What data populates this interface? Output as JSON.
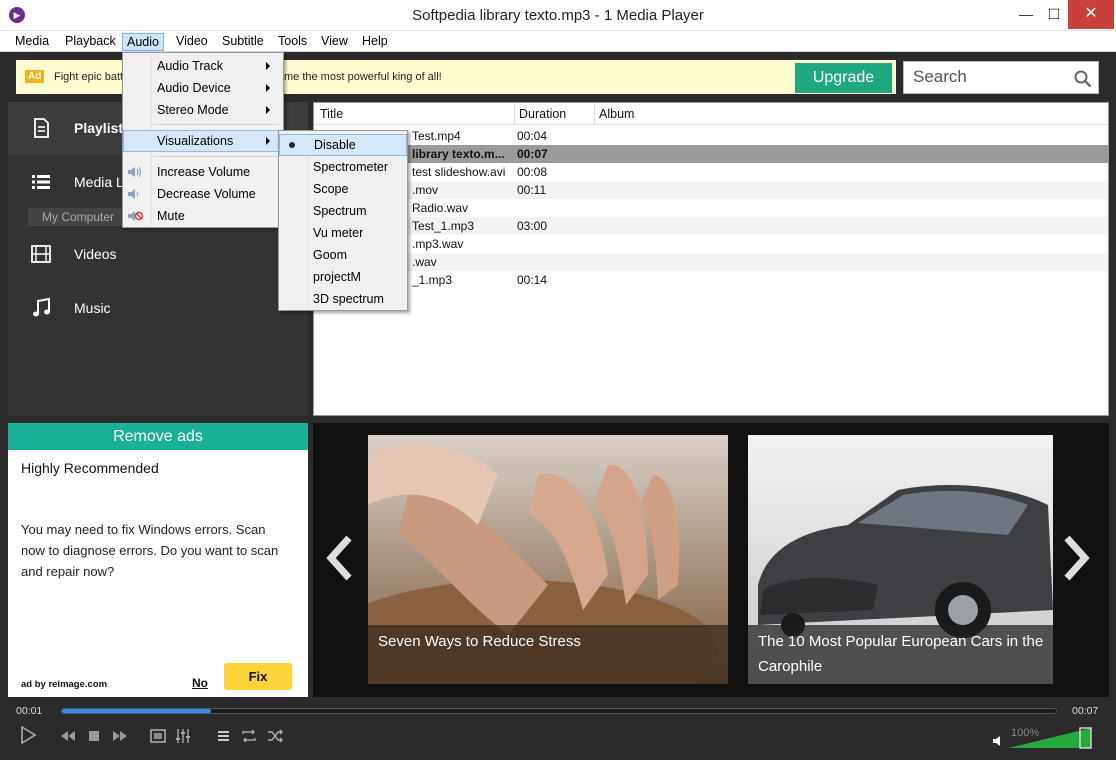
{
  "window": {
    "title": "Softpedia library texto.mp3 - 1 Media Player",
    "minimize": "—",
    "maximize": "☐",
    "close": "✕"
  },
  "menubar": [
    "Media",
    "Playback",
    "Audio",
    "Video",
    "Subtitle",
    "Tools",
    "View",
    "Help"
  ],
  "ad": {
    "badge": "Ad",
    "text_left": "Fight epic batt",
    "text_right": "me the most powerful king of all!",
    "upgrade": "Upgrade"
  },
  "search": {
    "placeholder": "Search"
  },
  "sidebar": {
    "playlist": "Playlist",
    "media_library": "Media Li",
    "my_computer": "My Computer",
    "videos": "Videos",
    "music": "Music"
  },
  "playlist": {
    "columns": [
      "Title",
      "Duration",
      "Album"
    ],
    "rows": [
      {
        "title": "Test.mp4",
        "duration": "00:04"
      },
      {
        "title": "library texto.m...",
        "duration": "00:07",
        "playing": true
      },
      {
        "title": "test slideshow.avi",
        "duration": "00:08"
      },
      {
        "title": ".mov",
        "duration": "00:11"
      },
      {
        "title": "Radio.wav",
        "duration": ""
      },
      {
        "title": "Test_1.mp3",
        "duration": "03:00"
      },
      {
        "title": ".mp3.wav",
        "duration": ""
      },
      {
        "title": ".wav",
        "duration": ""
      },
      {
        "title": "_1.mp3",
        "duration": "00:14"
      }
    ]
  },
  "recommend": {
    "header": "Remove ads",
    "title": "Highly Recommended",
    "message": "You may need to fix Windows errors. Scan now to diagnose errors. Do you want to scan and repair now?",
    "by": "ad by reimage.com",
    "no": "No",
    "fix": "Fix"
  },
  "carousel": {
    "cards": [
      {
        "caption": "Seven Ways to Reduce Stress"
      },
      {
        "caption": "The 10 Most Popular European Cars in the Carophile"
      }
    ]
  },
  "controls": {
    "elapsed": "00:01",
    "total": "00:07",
    "progress": 0.15,
    "volume": "100%",
    "volume_level": 1.0,
    "accent": "#2f8fe8"
  },
  "audio_menu": {
    "items": [
      "Audio Track",
      "Audio Device",
      "Stereo Mode",
      "Visualizations",
      "Increase Volume",
      "Decrease Volume",
      "Mute"
    ]
  },
  "visualizations_menu": {
    "items": [
      "Disable",
      "Spectrometer",
      "Scope",
      "Spectrum",
      "Vu meter",
      "Goom",
      "projectM",
      "3D spectrum"
    ],
    "selected": "Disable"
  }
}
